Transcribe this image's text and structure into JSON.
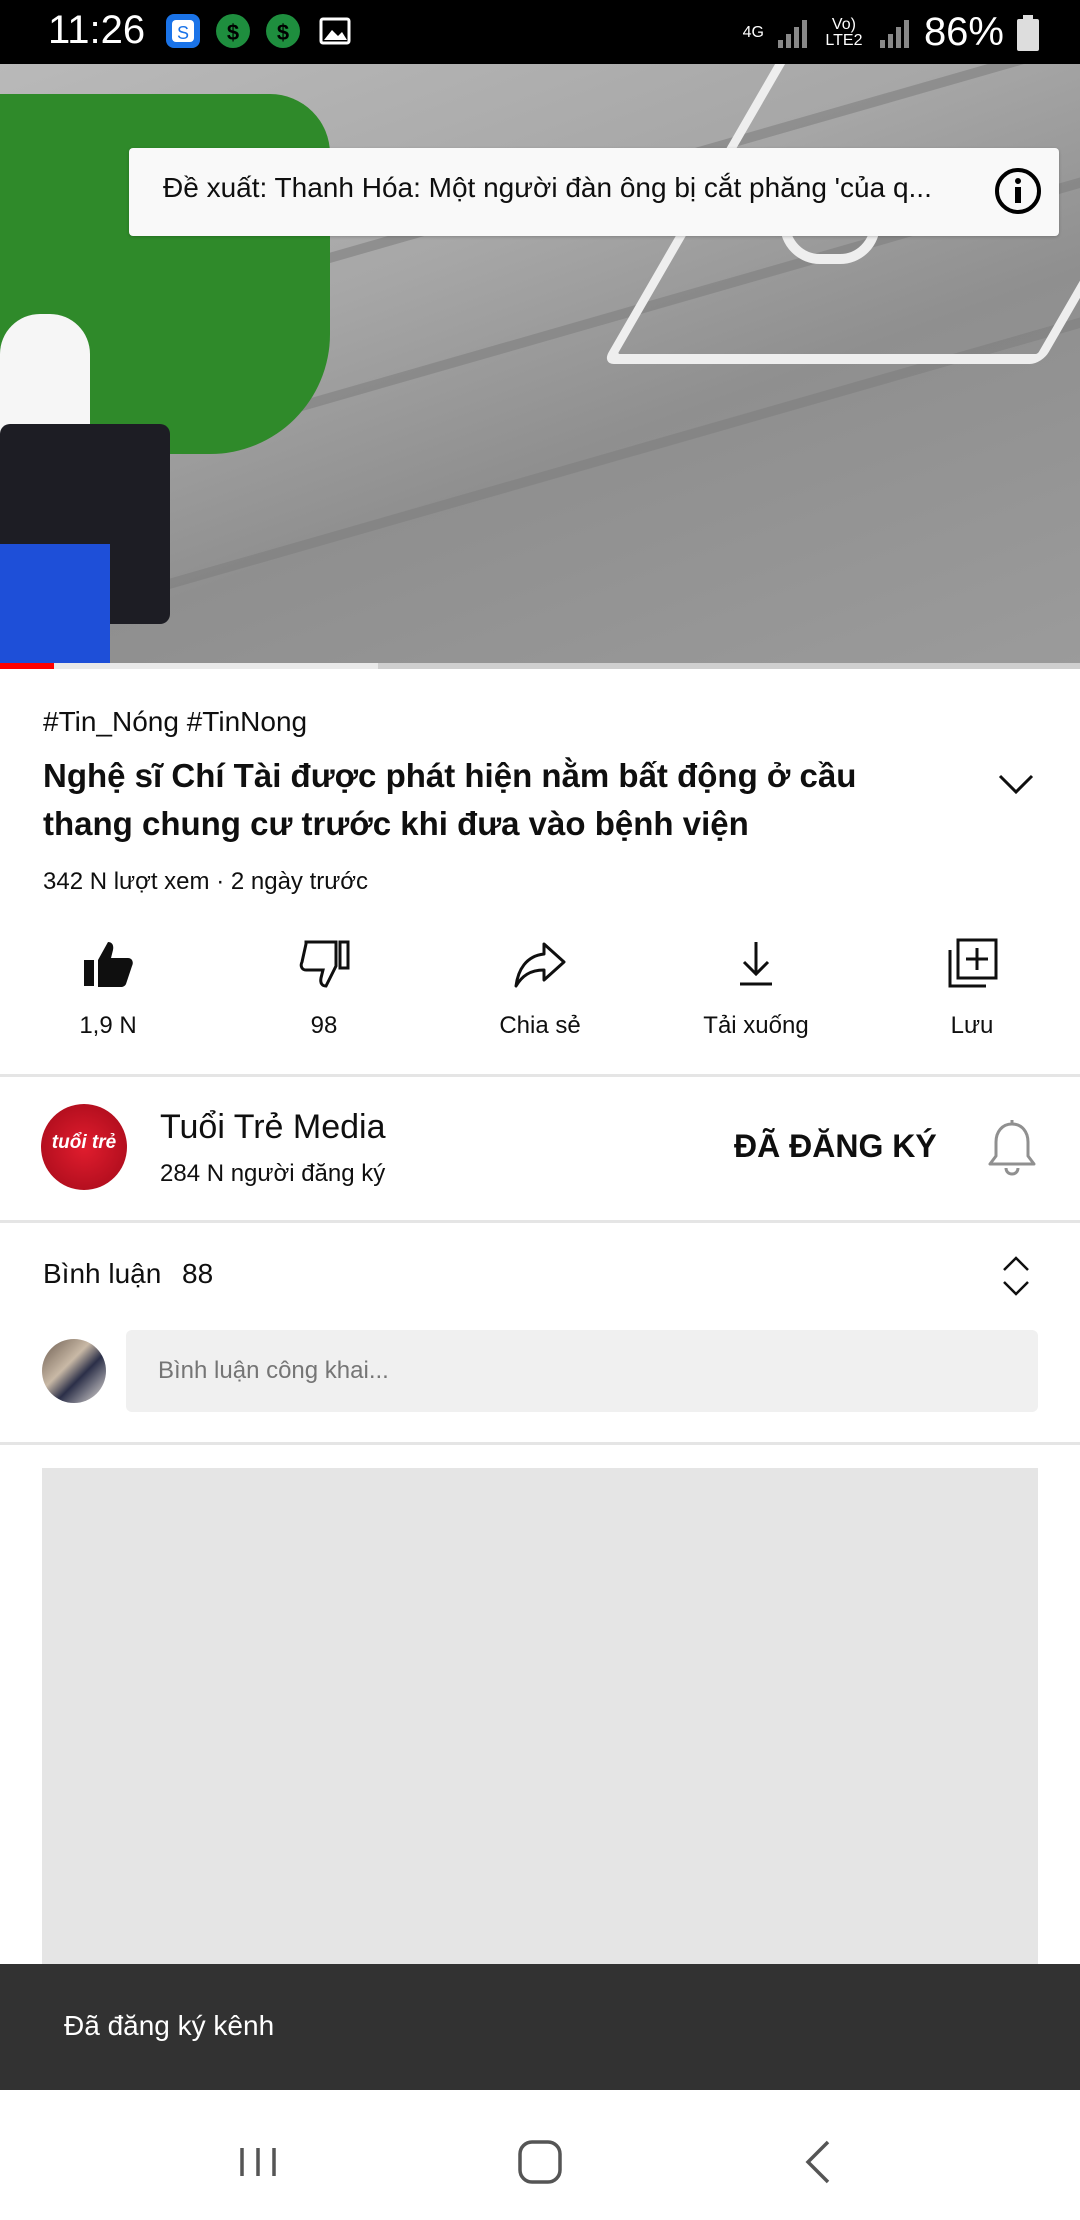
{
  "status_bar": {
    "time": "11:26",
    "network": "4G",
    "volte": "Vo) LTE2",
    "battery": "86%",
    "icons": [
      "s-app-icon",
      "dollar-icon",
      "dollar-icon",
      "image-icon",
      "signal-icon",
      "battery-icon"
    ]
  },
  "video": {
    "suggestion_text": "Đề xuất: Thanh Hóa: Một người đàn ông bị cắt phăng 'của q...",
    "progress_fraction": 0.05,
    "buffered_fraction": 0.35
  },
  "meta": {
    "hashtags": "#Tin_Nóng #TinNong",
    "title": "Nghệ sĩ Chí Tài được phát hiện nằm bất động ở cầu thang chung cư trước khi đưa vào bệnh viện",
    "views": "342 N lượt xem · 2 ngày trước"
  },
  "actions": [
    {
      "label": "1,9 N",
      "icon": "thumbs-up-icon"
    },
    {
      "label": "98",
      "icon": "thumbs-down-icon"
    },
    {
      "label": "Chia sẻ",
      "icon": "share-icon"
    },
    {
      "label": "Tải xuống",
      "icon": "download-icon"
    },
    {
      "label": "Lưu",
      "icon": "add-to-playlist-icon"
    }
  ],
  "channel": {
    "avatar_text": "tuổi trẻ",
    "name": "Tuổi Trẻ Media",
    "subscribers": "284 N người đăng ký",
    "subscribe_label": "ĐÃ ĐĂNG KÝ"
  },
  "comments": {
    "label": "Bình luận",
    "count": "88",
    "placeholder": "Bình luận công khai..."
  },
  "snackbar": {
    "text": "Đã đăng ký kênh"
  },
  "colors": {
    "accent_red": "#ff0000",
    "snackbar_bg": "#323232",
    "input_bg": "#f0f0f0"
  }
}
